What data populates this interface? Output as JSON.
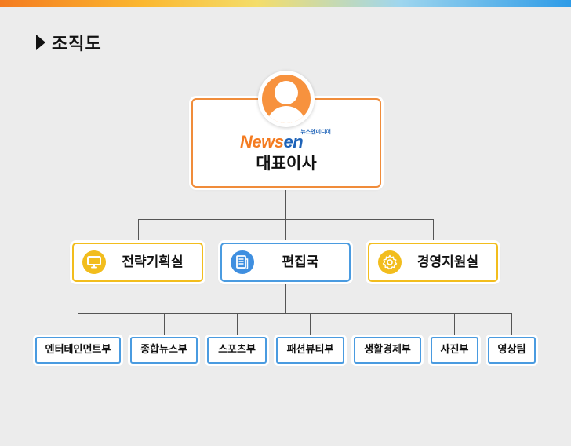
{
  "page": {
    "title": "조직도"
  },
  "ceo": {
    "logo_main_a": "News",
    "logo_main_b": "en",
    "logo_sub": "뉴스엔미디어",
    "label": "대표이사",
    "avatar_icon": "user-avatar-icon",
    "border_color": "#f08c3a"
  },
  "departments": [
    {
      "label": "전략기획실",
      "icon": "monitor-icon",
      "color": "#f2bd1d"
    },
    {
      "label": "편집국",
      "icon": "document-icon",
      "color": "#3f8fe0"
    },
    {
      "label": "경영지원실",
      "icon": "gear-icon",
      "color": "#f2bd1d"
    }
  ],
  "teams": [
    {
      "label": "엔터테인먼트부"
    },
    {
      "label": "종합뉴스부"
    },
    {
      "label": "스포츠부"
    },
    {
      "label": "패션뷰티부"
    },
    {
      "label": "생활경제부"
    },
    {
      "label": "사진부"
    },
    {
      "label": "영상팀"
    }
  ]
}
